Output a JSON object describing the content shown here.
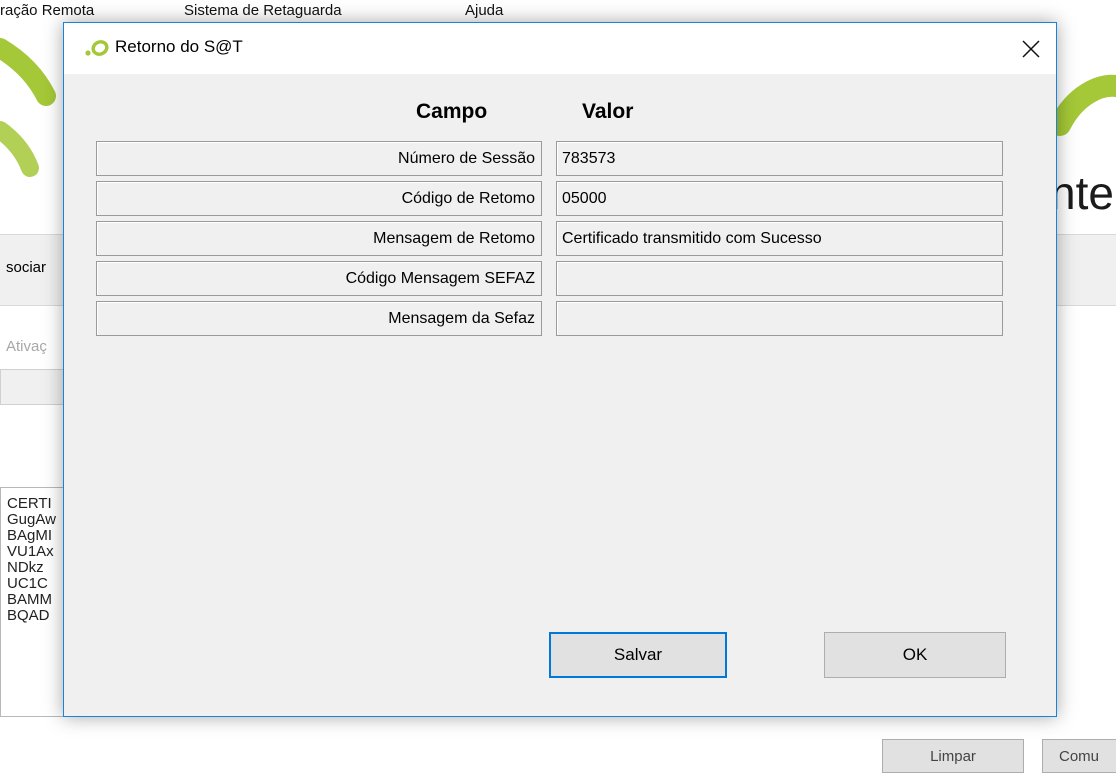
{
  "background_app": {
    "menu": [
      "ração Remota",
      "Sistema de Retaguarda",
      "Ajuda"
    ],
    "brand_partial": "nte",
    "tab_partial": "sociar",
    "field_label_partial": "Ativaç",
    "certificate_lines": [
      "CERTI",
      "GugAw",
      "BAgMI",
      "VU1Ax",
      "NDkz",
      "UC1C",
      "BAMM",
      "BQAD"
    ],
    "buttons": {
      "clear": "Limpar",
      "comm": "Comu"
    },
    "colors": {
      "logo_green": "#a4c837"
    }
  },
  "dialog": {
    "title": "Retorno do S@T",
    "icon": "sat-logo-icon",
    "close_icon": "close-icon",
    "headers": {
      "field": "Campo",
      "value": "Valor"
    },
    "rows": [
      {
        "field": "Número de Sessão",
        "value": "783573"
      },
      {
        "field": "Código de Retomo",
        "value": "05000"
      },
      {
        "field": "Mensagem de Retomo",
        "value": "Certificado transmitido com Sucesso"
      },
      {
        "field": "Código Mensagem SEFAZ",
        "value": ""
      },
      {
        "field": "Mensagem da Sefaz",
        "value": ""
      }
    ],
    "buttons": {
      "save": "Salvar",
      "ok": "OK"
    },
    "colors": {
      "border": "#1883d7",
      "default_button_border": "#0078d7"
    }
  }
}
